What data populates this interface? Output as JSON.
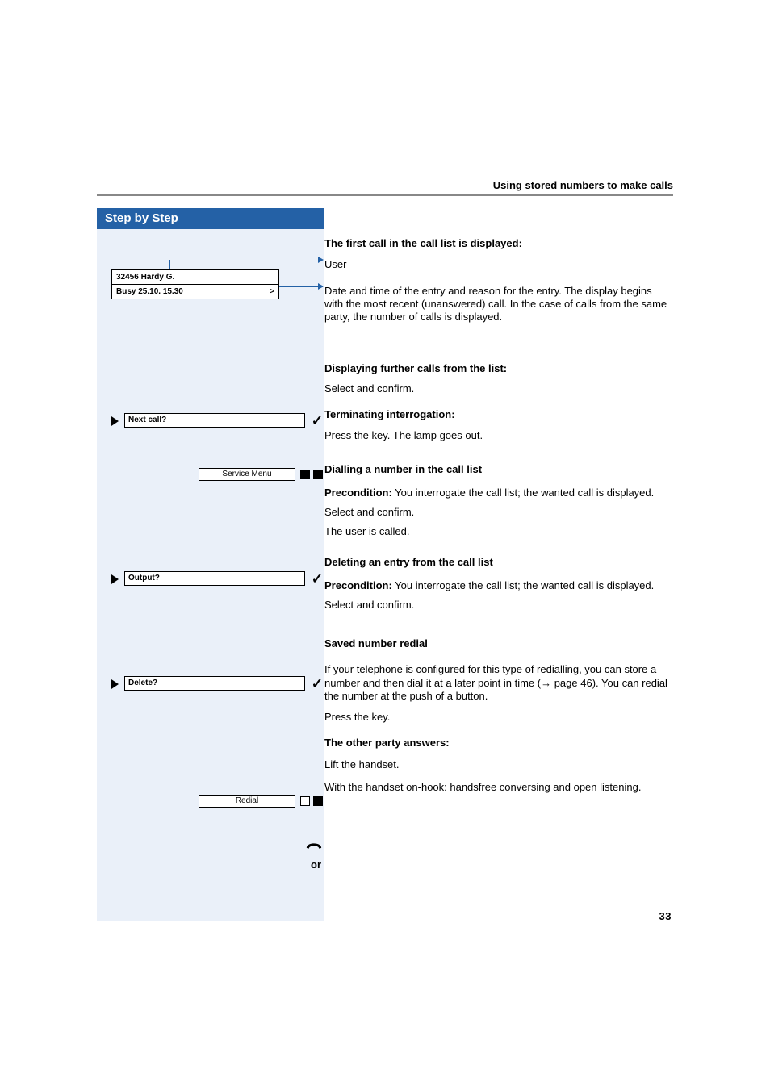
{
  "header": {
    "section_title": "Using stored numbers to make calls"
  },
  "sidebar": {
    "title": "Step by Step",
    "display": {
      "line1": "32456 Hardy G.",
      "line2_left": "Busy 25.10. 15.30",
      "line2_right": ">"
    },
    "items": {
      "next_call": "Next call?",
      "output": "Output?",
      "delete": "Delete?"
    },
    "keys": {
      "service_menu": "Service Menu",
      "redial": "Redial"
    },
    "or_label": "or"
  },
  "content": {
    "first_call_heading": "The first call in the call list is displayed:",
    "user_label": "User",
    "entry_desc": "Date and time of the entry and reason for the entry. The display begins with the most recent (unanswered) call. In the case of calls from the same party, the number of calls is displayed.",
    "further_calls_heading": "Displaying further calls from the list:",
    "select_confirm": "Select and confirm.",
    "terminating_heading": "Terminating interrogation:",
    "press_key_lamp": "Press the key. The lamp goes out.",
    "dialling_heading": "Dialling a number in the call list",
    "precondition_label": "Precondition:",
    "precondition_text": " You interrogate the call list; the wanted call is displayed.",
    "user_called": "The user is called.",
    "deleting_heading": "Deleting an entry from the call list",
    "saved_redial_heading": "Saved number redial",
    "saved_redial_body_pre": "If your telephone is configured for this type of redialling, you can store a number and then dial it at a later point in time (",
    "saved_redial_pageref": " page 46). You can redial the number at the push of a button.",
    "press_key": "Press the key.",
    "other_party_heading": "The other party answers:",
    "lift_handset": "Lift the handset.",
    "handsfree": "With the handset on-hook: handsfree conversing and open listening."
  },
  "page_number": "33"
}
